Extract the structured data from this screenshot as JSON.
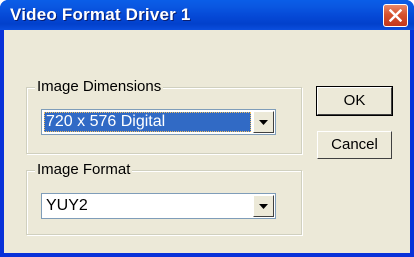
{
  "window": {
    "title": "Video Format Driver 1"
  },
  "image_dimensions": {
    "group_label": "Image Dimensions",
    "selected_value": "720 x 576 Digital"
  },
  "image_format": {
    "group_label": "Image Format",
    "selected_value": "YUY2"
  },
  "buttons": {
    "ok_label": "OK",
    "cancel_label": "Cancel"
  },
  "icons": {
    "close": "close-icon",
    "dropdown": "chevron-down-icon"
  },
  "colors": {
    "titlebar": "#0548d6",
    "close_button": "#d6522e",
    "dialog_face": "#ece9d8",
    "selection": "#316ac5"
  }
}
